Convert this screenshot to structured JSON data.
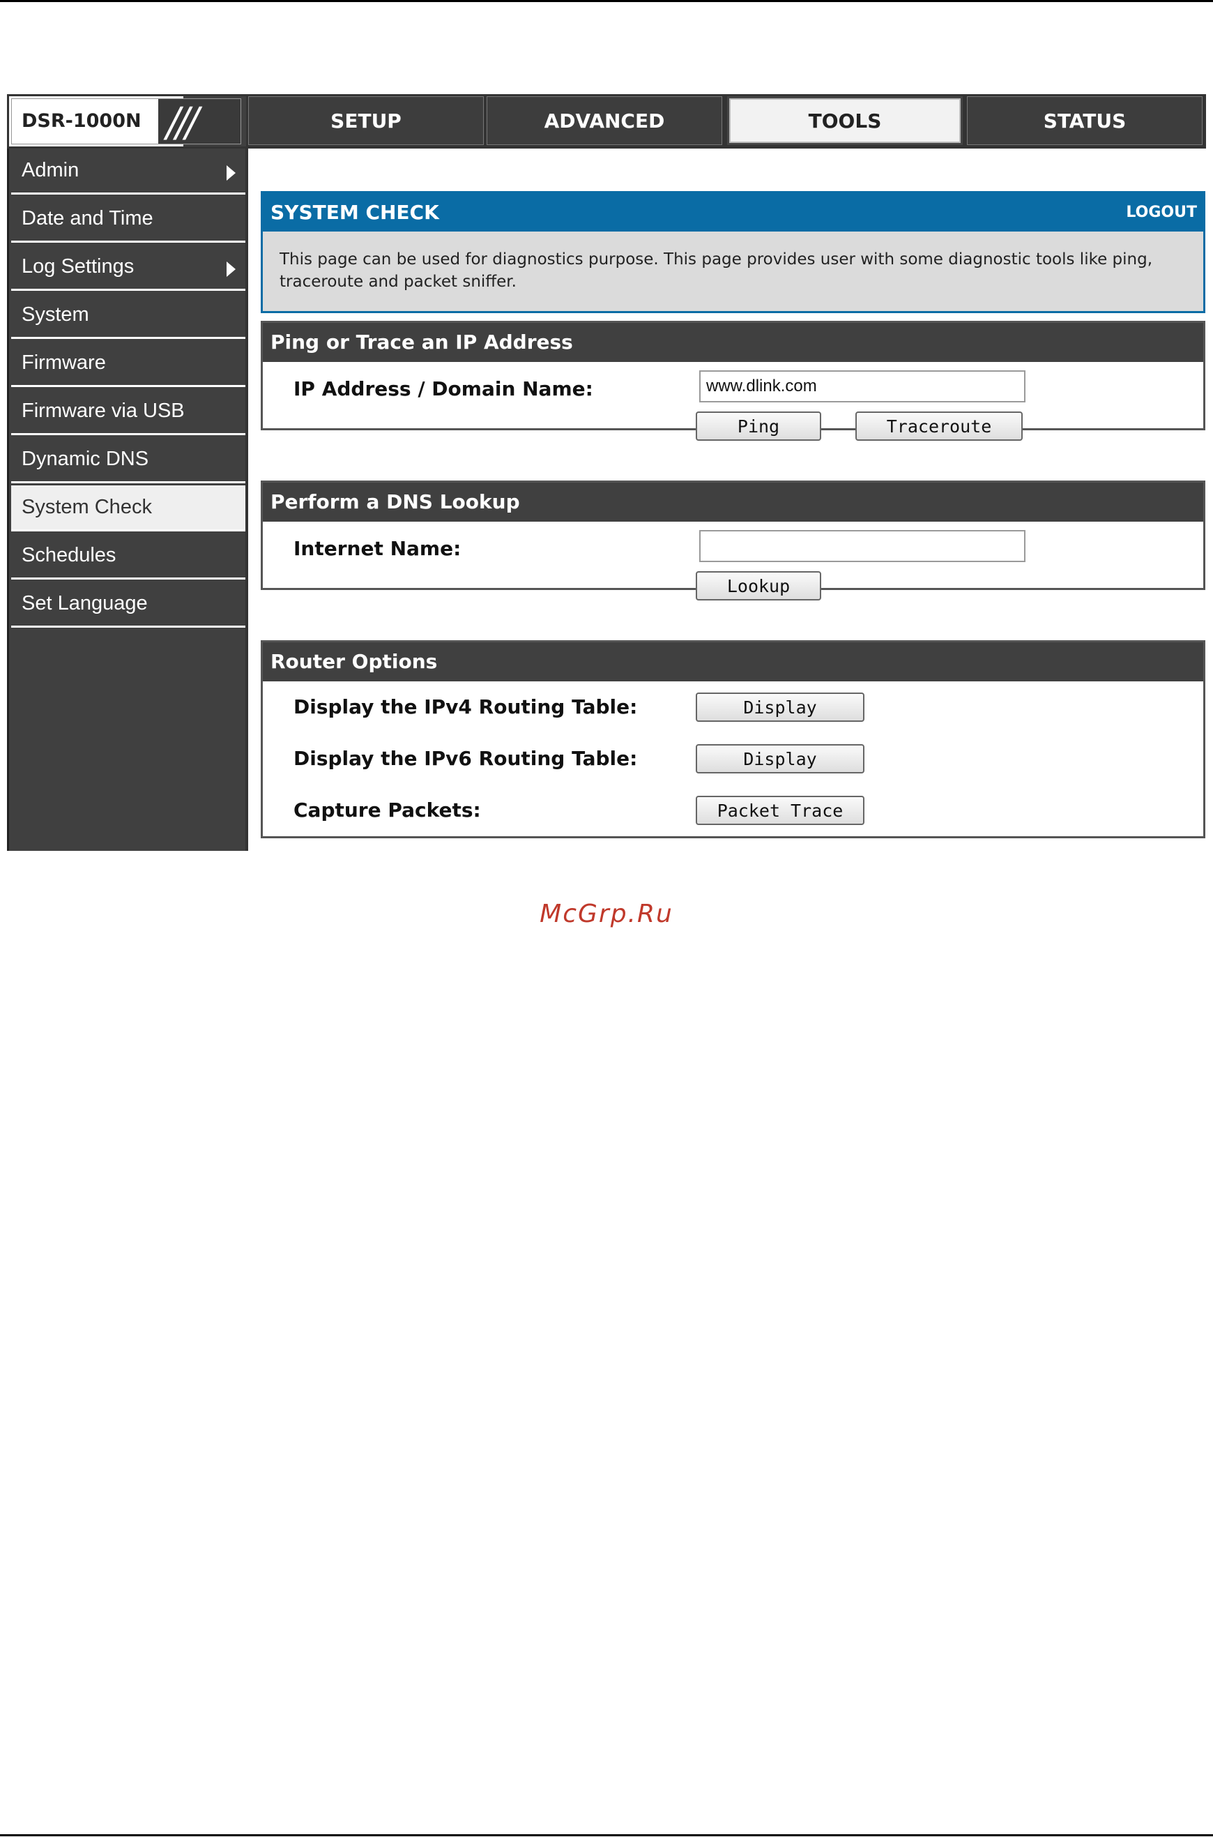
{
  "brand": {
    "model": "DSR-1000N"
  },
  "tabs": [
    {
      "label": "SETUP"
    },
    {
      "label": "ADVANCED"
    },
    {
      "label": "TOOLS",
      "active": true
    },
    {
      "label": "STATUS"
    }
  ],
  "sidebar": {
    "items": [
      {
        "label": "Admin",
        "has_submenu": true
      },
      {
        "label": "Date and Time"
      },
      {
        "label": "Log Settings",
        "has_submenu": true
      },
      {
        "label": "System"
      },
      {
        "label": "Firmware"
      },
      {
        "label": "Firmware via USB"
      },
      {
        "label": "Dynamic DNS"
      },
      {
        "label": "System Check",
        "active": true
      },
      {
        "label": "Schedules"
      },
      {
        "label": "Set Language"
      }
    ]
  },
  "page": {
    "title": "SYSTEM CHECK",
    "logout_label": "LOGOUT",
    "description": "This page can be used for diagnostics purpose. This page provides user with some diagnostic tools like ping, traceroute and packet sniffer."
  },
  "ping_section": {
    "title": "Ping or Trace an IP Address",
    "field_label": "IP Address / Domain Name:",
    "field_value": "www.dlink.com",
    "ping_label": "Ping",
    "traceroute_label": "Traceroute"
  },
  "dns_section": {
    "title": "Perform a DNS Lookup",
    "field_label": "Internet Name:",
    "field_value": "",
    "lookup_label": "Lookup"
  },
  "router_section": {
    "title": "Router Options",
    "ipv4_label": "Display the IPv4 Routing Table:",
    "ipv4_button": "Display",
    "ipv6_label": "Display the IPv6 Routing Table:",
    "ipv6_button": "Display",
    "capture_label": "Capture Packets:",
    "capture_button": "Packet Trace"
  },
  "watermark": "McGrp.Ru",
  "colors": {
    "header_blue": "#0a6ca5",
    "dark_gray": "#404040",
    "desc_gray": "#dbdbdb",
    "watermark_red": "#c0392b"
  }
}
